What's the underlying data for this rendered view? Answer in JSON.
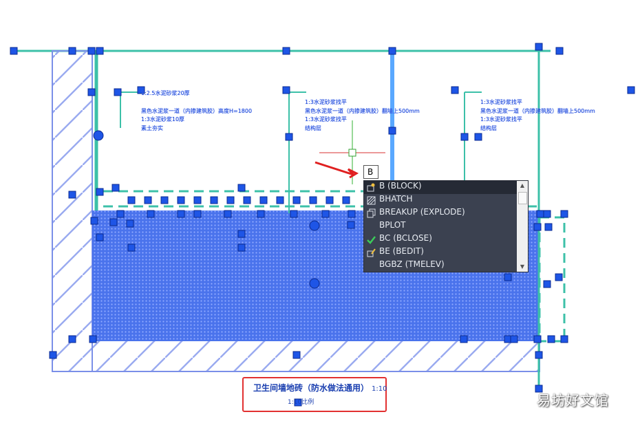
{
  "command_input": {
    "value": "B"
  },
  "autocomplete": {
    "items": [
      {
        "label": "B (BLOCK)",
        "icon": "block-icon",
        "selected": true
      },
      {
        "label": "BHATCH",
        "icon": "hatch-icon"
      },
      {
        "label": "BREAKUP (EXPLODE)",
        "icon": "explode-icon"
      },
      {
        "label": "BPLOT",
        "icon": ""
      },
      {
        "label": "BC (BCLOSE)",
        "icon": "checkmark-icon"
      },
      {
        "label": "BE (BEDIT)",
        "icon": "block-edit-icon"
      },
      {
        "label": "BGBZ (TMELEV)",
        "icon": ""
      }
    ]
  },
  "drawing": {
    "title": "卫生间墙地砖（防水做法通用）",
    "scale": "1:10",
    "subtitle": "1:10比例",
    "notes_left": [
      "1:2.5水泥砂浆20厚",
      "黑色水泥浆一道（内掺建筑胶）高度H=1800",
      "1:3水泥砂浆10厚",
      "素土夯实"
    ],
    "notes_mid": [
      "1:3水泥砂浆找平",
      "黑色水泥浆一道（内掺建筑胶）翻墙上500mm",
      "1:3水泥砂浆找平",
      "结构层"
    ],
    "notes_right": [
      "1:3水泥砂浆找平",
      "黑色水泥浆一道（内掺建筑胶）翻墙上500mm",
      "1:3水泥砂浆找平",
      "结构层"
    ]
  },
  "watermark": "易坊好文馆",
  "colors": {
    "grip": "#1e55e6",
    "line": "#3cc0a8",
    "hatch": "#3f6ae8",
    "selection_box": "#e23030"
  }
}
